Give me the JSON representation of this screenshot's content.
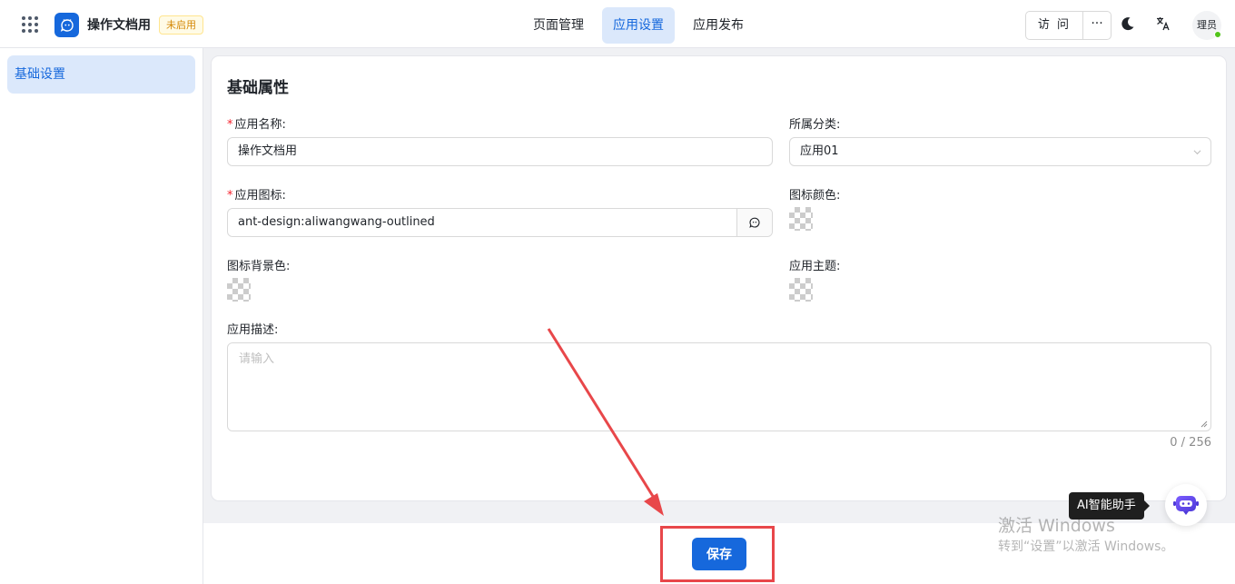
{
  "header": {
    "app_title": "操作文档用",
    "status_badge": "未启用",
    "tabs": [
      {
        "label": "页面管理",
        "active": false
      },
      {
        "label": "应用设置",
        "active": true
      },
      {
        "label": "应用发布",
        "active": false
      }
    ],
    "visit_label": "访 问",
    "more_label": "···",
    "avatar_text": "理员"
  },
  "sidebar": {
    "items": [
      {
        "label": "基础设置",
        "active": true
      }
    ]
  },
  "form": {
    "section_title": "基础属性",
    "app_name": {
      "label": "应用名称:",
      "value": "操作文档用",
      "required": true
    },
    "category": {
      "label": "所属分类:",
      "value": "应用01"
    },
    "app_icon": {
      "label": "应用图标:",
      "value": "ant-design:aliwangwang-outlined",
      "required": true
    },
    "icon_color": {
      "label": "图标颜色:"
    },
    "icon_bg_color": {
      "label": "图标背景色:"
    },
    "app_theme": {
      "label": "应用主题:"
    },
    "description": {
      "label": "应用描述:",
      "placeholder": "请输入",
      "counter": "0 / 256"
    }
  },
  "footer": {
    "save_label": "保存"
  },
  "ai_assistant": {
    "tooltip": "AI智能助手"
  },
  "watermark": {
    "line1": "激活 Windows",
    "line2": "转到“设置”以激活 Windows。"
  },
  "colors": {
    "primary": "#1668dc",
    "active_bg": "#dbe8fb",
    "annotation_red": "#e8474a",
    "badge_text": "#d48806",
    "online": "#52c41a"
  },
  "icons": {
    "apps_grid": "apps-grid-icon",
    "app_logo": "aliwangwang-icon",
    "dark_mode": "moon-icon",
    "translate": "translate-icon",
    "select_arrow": "chevron-down-icon",
    "ai_assistant": "robot-icon"
  }
}
